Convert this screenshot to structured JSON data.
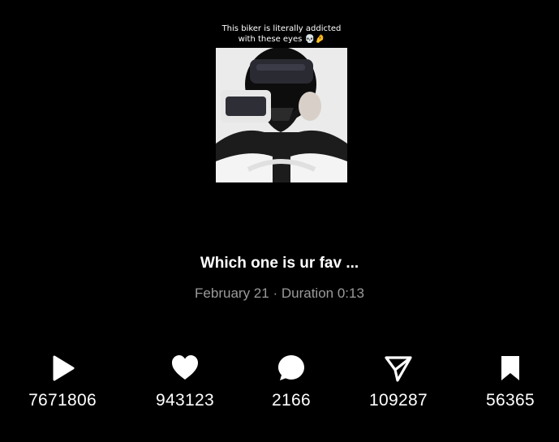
{
  "video": {
    "thumbnail_caption": "This biker is literally addicted\nwith these eyes 💀🤌",
    "title": "Which one is ur fav ...",
    "date": "February 21",
    "separator": "·",
    "duration": "Duration 0:13"
  },
  "stats": [
    {
      "icon": "play-icon",
      "count": "7671806"
    },
    {
      "icon": "heart-icon",
      "count": "943123"
    },
    {
      "icon": "comment-icon",
      "count": "2166"
    },
    {
      "icon": "share-icon",
      "count": "109287"
    },
    {
      "icon": "bookmark-icon",
      "count": "56365"
    }
  ],
  "colors": {
    "background": "#000000",
    "text": "#ffffff",
    "meta_text": "#9a9a9a"
  }
}
